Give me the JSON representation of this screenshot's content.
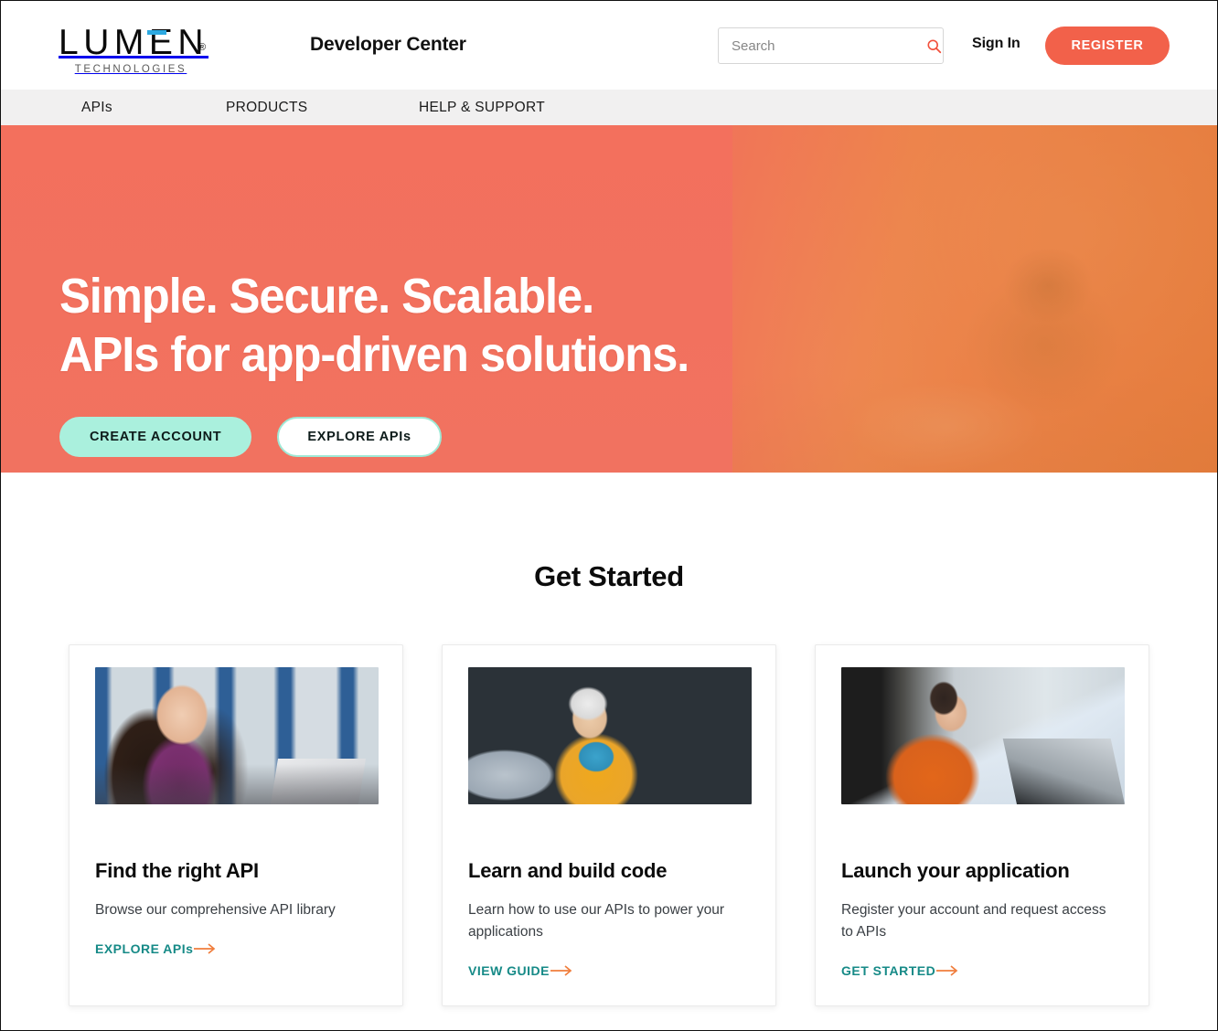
{
  "header": {
    "logo": {
      "mark": "LUMEN",
      "registered": "®",
      "subtitle": "TECHNOLOGIES"
    },
    "site_title": "Developer Center",
    "search": {
      "placeholder": "Search",
      "value": "",
      "icon": "search-icon"
    },
    "sign_in_label": "Sign In",
    "register_label": "REGISTER"
  },
  "nav": {
    "items": [
      {
        "label": "APIs"
      },
      {
        "label": "PRODUCTS"
      },
      {
        "label": "HELP & SUPPORT"
      }
    ]
  },
  "hero": {
    "headline_line1": "Simple. Secure. Scalable.",
    "headline_line2": "APIs for app-driven solutions.",
    "primary_button": "CREATE ACCOUNT",
    "secondary_button": "EXPLORE APIs"
  },
  "get_started": {
    "title": "Get Started",
    "cards": [
      {
        "image_alt": "woman-with-glasses-at-laptop",
        "title": "Find the right API",
        "text": "Browse our comprehensive API library",
        "link_label": "EXPLORE APIs"
      },
      {
        "image_alt": "woman-with-mug-at-laptop",
        "title": "Learn and build code",
        "text": "Learn how to use our APIs to power your applications",
        "link_label": "VIEW GUIDE"
      },
      {
        "image_alt": "woman-in-orange-sweater-typing",
        "title": "Launch your application",
        "text": "Register your account and request access to APIs",
        "link_label": "GET STARTED"
      }
    ]
  },
  "colors": {
    "brand_coral": "#f2614a",
    "hero_coral": "#f2705c",
    "hero_orange": "#e08230",
    "logo_blue": "#2ca9e1",
    "mint": "#aaf0dd",
    "link_teal": "#168a87",
    "arrow_orange": "#f07d3c",
    "nav_bg": "#f1f0f0"
  }
}
